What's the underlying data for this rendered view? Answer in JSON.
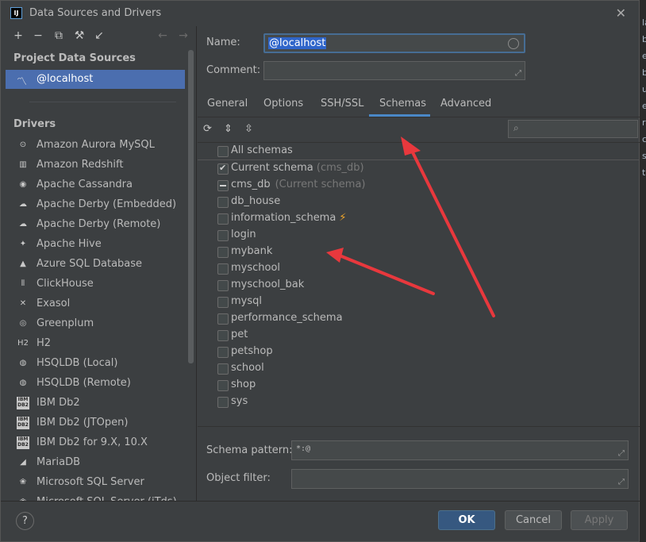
{
  "window": {
    "title": "Data Sources and Drivers",
    "app_icon_text": "IJ"
  },
  "left": {
    "project_title": "Project Data Sources",
    "project_item": "@localhost",
    "drivers_title": "Drivers",
    "drivers": [
      {
        "label": "Amazon Aurora MySQL",
        "icon": "aurora-icon",
        "glyph": "⊙"
      },
      {
        "label": "Amazon Redshift",
        "icon": "redshift-icon",
        "glyph": "▥"
      },
      {
        "label": "Apache Cassandra",
        "icon": "cassandra-icon",
        "glyph": "◉"
      },
      {
        "label": "Apache Derby (Embedded)",
        "icon": "derby-icon",
        "glyph": "☁"
      },
      {
        "label": "Apache Derby (Remote)",
        "icon": "derby-icon",
        "glyph": "☁"
      },
      {
        "label": "Apache Hive",
        "icon": "hive-icon",
        "glyph": "✦"
      },
      {
        "label": "Azure SQL Database",
        "icon": "azure-icon",
        "glyph": "▲"
      },
      {
        "label": "ClickHouse",
        "icon": "clickhouse-icon",
        "glyph": "⦀"
      },
      {
        "label": "Exasol",
        "icon": "exasol-icon",
        "glyph": "✕"
      },
      {
        "label": "Greenplum",
        "icon": "greenplum-icon",
        "glyph": "◎"
      },
      {
        "label": "H2",
        "icon": "h2-icon",
        "glyph": "H2"
      },
      {
        "label": "HSQLDB (Local)",
        "icon": "hsqldb-icon",
        "glyph": "◍"
      },
      {
        "label": "HSQLDB (Remote)",
        "icon": "hsqldb-icon",
        "glyph": "◍"
      },
      {
        "label": "IBM Db2",
        "icon": "db2-icon",
        "glyph": "IBM DB2"
      },
      {
        "label": "IBM Db2 (JTOpen)",
        "icon": "db2-icon",
        "glyph": "IBM DB2"
      },
      {
        "label": "IBM Db2 for 9.X, 10.X",
        "icon": "db2-icon",
        "glyph": "IBM DB2"
      },
      {
        "label": "MariaDB",
        "icon": "mariadb-icon",
        "glyph": "◢"
      },
      {
        "label": "Microsoft SQL Server",
        "icon": "mssql-icon",
        "glyph": "❀"
      },
      {
        "label": "Microsoft SQL Server (jTds)",
        "icon": "mssql-icon",
        "glyph": "❀"
      }
    ]
  },
  "form": {
    "name_label": "Name:",
    "name_value": "@localhost",
    "comment_label": "Comment:",
    "comment_value": ""
  },
  "tabs": [
    "General",
    "Options",
    "SSH/SSL",
    "Schemas",
    "Advanced"
  ],
  "active_tab": "Schemas",
  "schemas": {
    "all_label": "All schemas",
    "current_label": "Current schema",
    "current_note": "(cms_db)",
    "items": [
      {
        "name": "cms_db",
        "note": "(Current schema)",
        "state": "partial"
      },
      {
        "name": "db_house",
        "state": "unchecked"
      },
      {
        "name": "information_schema",
        "state": "unchecked",
        "bolt": "⚡"
      },
      {
        "name": "login",
        "state": "unchecked"
      },
      {
        "name": "mybank",
        "state": "unchecked"
      },
      {
        "name": "myschool",
        "state": "unchecked"
      },
      {
        "name": "myschool_bak",
        "state": "unchecked"
      },
      {
        "name": "mysql",
        "state": "unchecked"
      },
      {
        "name": "performance_schema",
        "state": "unchecked"
      },
      {
        "name": "pet",
        "state": "unchecked"
      },
      {
        "name": "petshop",
        "state": "unchecked"
      },
      {
        "name": "school",
        "state": "unchecked"
      },
      {
        "name": "shop",
        "state": "unchecked"
      },
      {
        "name": "sys",
        "state": "unchecked"
      }
    ],
    "pattern_label": "Schema pattern:",
    "pattern_value": "*:@",
    "filter_label": "Object filter:",
    "filter_value": ""
  },
  "buttons": {
    "ok": "OK",
    "cancel": "Cancel",
    "apply": "Apply",
    "help": "?"
  },
  "background_text": [
    "la",
    "b",
    "e",
    "b",
    "u",
    "e",
    "ri",
    "c",
    "s",
    "t"
  ],
  "colors": {
    "selection": "#4b6eaf",
    "ok_button": "#365880",
    "tab_underline": "#4a88c7",
    "annotation": "#e8383d"
  }
}
